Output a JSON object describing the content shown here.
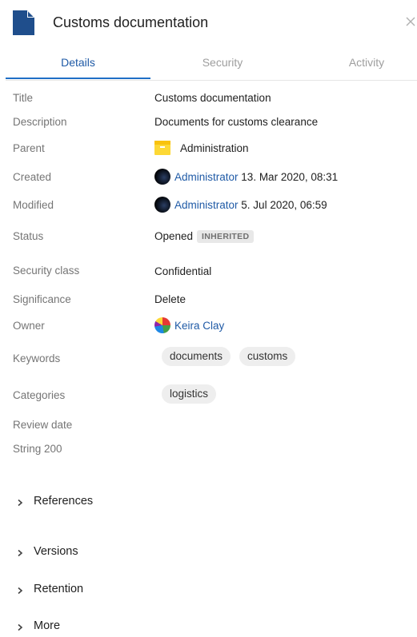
{
  "header": {
    "title": "Customs documentation",
    "icon": "document-icon",
    "close_icon": "close-icon"
  },
  "tabs": [
    {
      "label": "Details",
      "active": true
    },
    {
      "label": "Security",
      "active": false
    },
    {
      "label": "Activity",
      "active": false
    }
  ],
  "fields": {
    "title": {
      "label": "Title",
      "value": "Customs documentation"
    },
    "description": {
      "label": "Description",
      "value": "Documents for customs clearance"
    },
    "parent": {
      "label": "Parent",
      "value": "Administration",
      "icon": "folder-icon"
    },
    "created": {
      "label": "Created",
      "user": "Administrator",
      "date": "13. Mar 2020, 08:31"
    },
    "modified": {
      "label": "Modified",
      "user": "Administrator",
      "date": "5. Jul 2020, 06:59"
    },
    "status": {
      "label": "Status",
      "value": "Opened",
      "badge": "INHERITED"
    },
    "security_class": {
      "label": "Security class",
      "value": "Confidential"
    },
    "significance": {
      "label": "Significance",
      "value": "Delete"
    },
    "owner": {
      "label": "Owner",
      "value": "Keira Clay"
    },
    "keywords": {
      "label": "Keywords",
      "chips": [
        "documents",
        "customs"
      ]
    },
    "categories": {
      "label": "Categories",
      "chips": [
        "logistics"
      ]
    },
    "review_date": {
      "label": "Review date"
    },
    "string200": {
      "label": "String 200"
    }
  },
  "sections": [
    {
      "label": "References"
    },
    {
      "label": "Versions"
    },
    {
      "label": "Retention"
    },
    {
      "label": "More"
    }
  ],
  "colors": {
    "accent": "#1f5aa6",
    "tab_ink": "#1f6fc6",
    "folder": "#fdd835",
    "doc_icon": "#1f4e8c"
  }
}
